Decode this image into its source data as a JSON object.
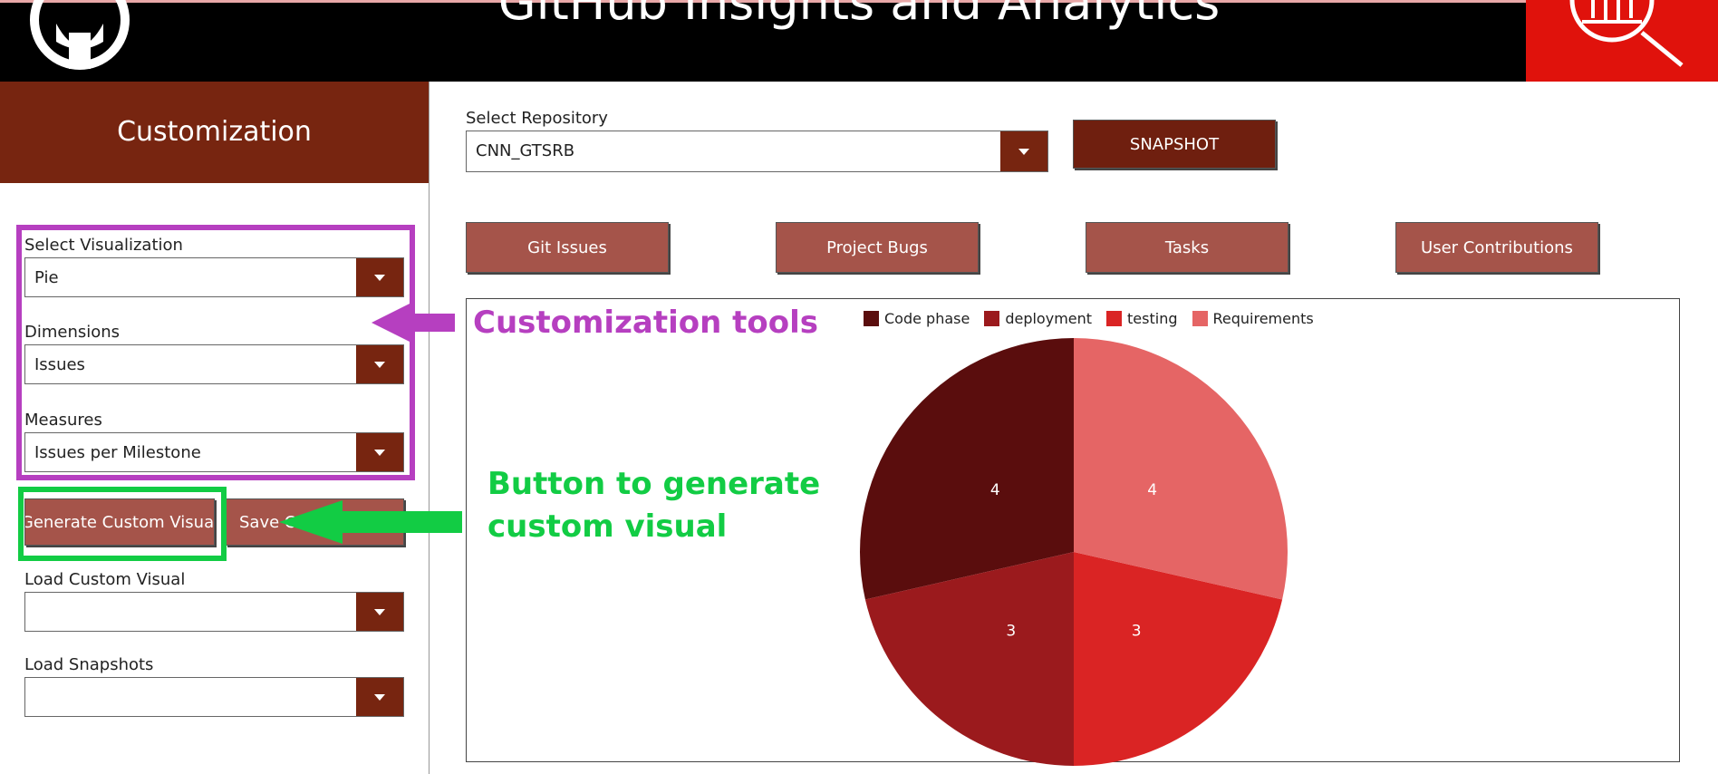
{
  "header": {
    "title": "GitHub Insights and Analytics"
  },
  "sidebar": {
    "title": "Customization",
    "visualization": {
      "label": "Select Visualization",
      "value": "Pie"
    },
    "dimensions": {
      "label": "Dimensions",
      "value": "Issues"
    },
    "measures": {
      "label": "Measures",
      "value": "Issues per Milestone"
    },
    "generate_button": "Generate Custom Visual",
    "save_button": "Save Cu",
    "load_custom": {
      "label": "Load Custom Visual",
      "value": ""
    },
    "load_snapshots": {
      "label": "Load Snapshots",
      "value": ""
    }
  },
  "main": {
    "repository": {
      "label": "Select Repository",
      "value": "CNN_GTSRB"
    },
    "snapshot_button": "SNAPSHOT",
    "tabs": [
      "Git Issues",
      "Project Bugs",
      "Tasks",
      "User Contributions"
    ]
  },
  "annotations": {
    "customization_tools": "Customization tools",
    "generate_line1": "Button to generate",
    "generate_line2": "custom visual",
    "colors": {
      "customization": "#b63fc0",
      "generate": "#12cc44"
    }
  },
  "chart_data": {
    "type": "pie",
    "categories": [
      "Code phase",
      "deployment",
      "testing",
      "Requirements"
    ],
    "values": [
      4,
      3,
      3,
      4
    ],
    "colors": [
      "#5a0d0d",
      "#9b1a1d",
      "#da2424",
      "#e56565"
    ],
    "legend": "top",
    "title": ""
  },
  "colors": {
    "brand": "#772510",
    "button": "#a5544a",
    "badge": "#e0120c"
  },
  "icons": [
    "github-logo-icon",
    "search-report-icon",
    "chevron-down-icon"
  ]
}
